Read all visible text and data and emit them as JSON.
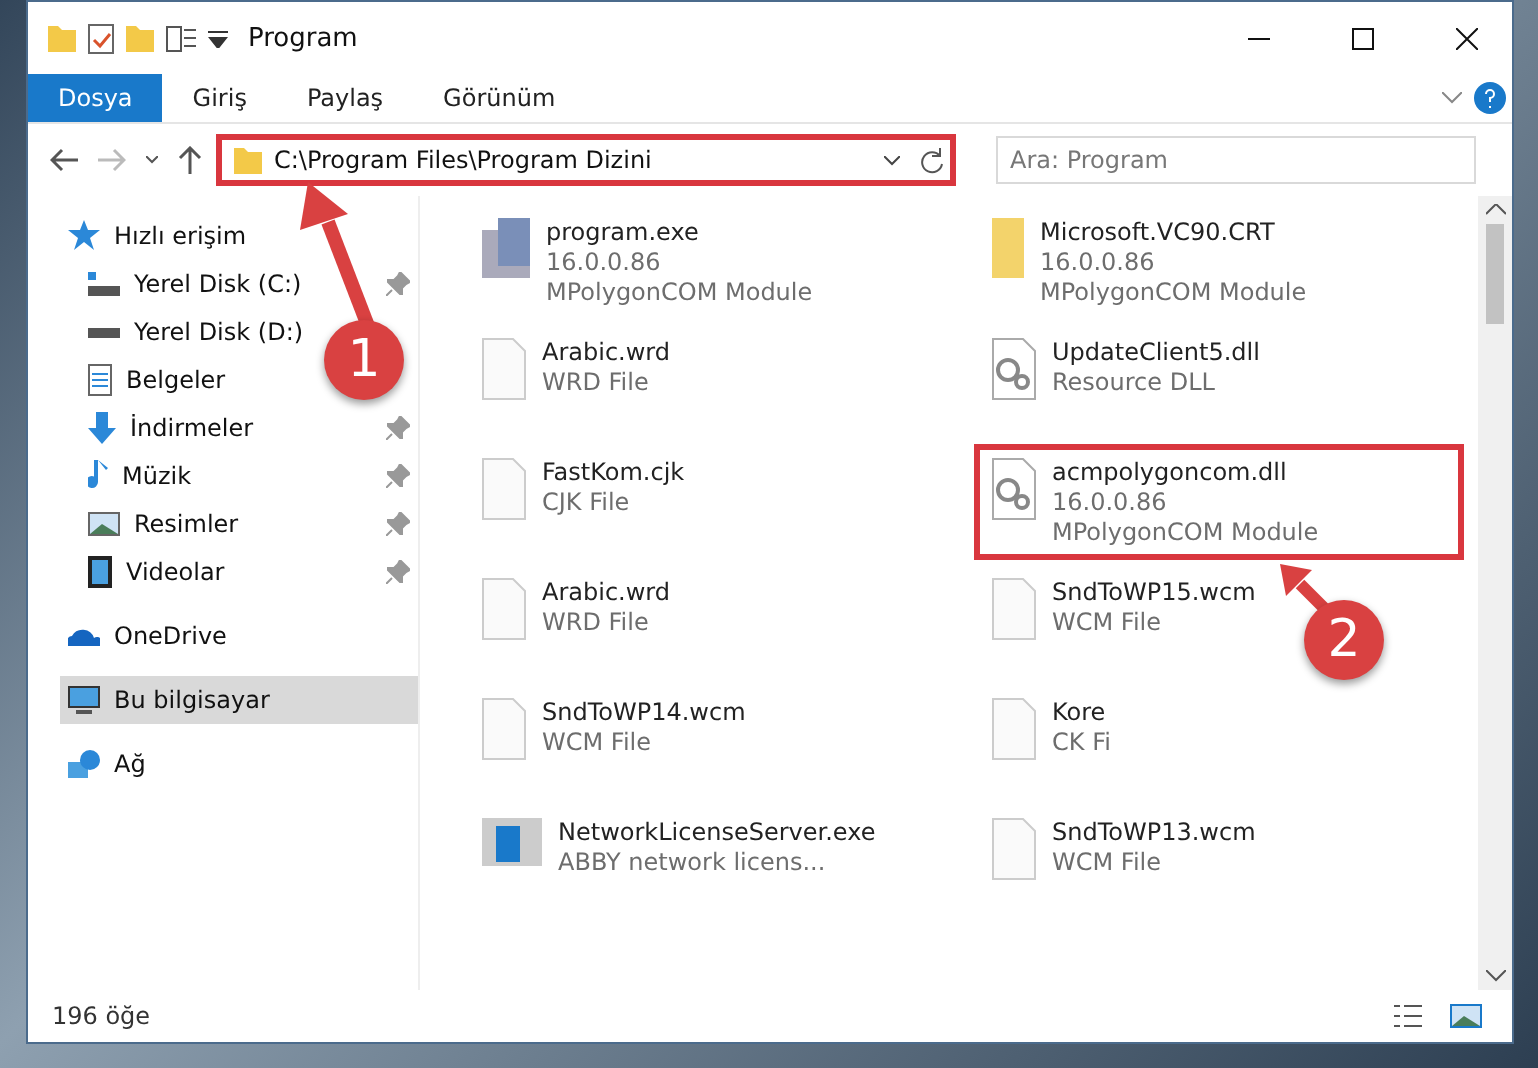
{
  "window": {
    "title": "Program"
  },
  "ribbon_tabs": [
    {
      "label": "Dosya",
      "selected": true
    },
    {
      "label": "Giriş",
      "selected": false
    },
    {
      "label": "Paylaş",
      "selected": false
    },
    {
      "label": "Görünüm",
      "selected": false
    }
  ],
  "address_bar": {
    "path": "C:\\Program Files\\Program Dizini",
    "highlighted": true
  },
  "search": {
    "placeholder": "Ara: Program"
  },
  "sidebar": {
    "items": [
      {
        "label": "Hızlı erişim",
        "selected": false,
        "children": [
          {
            "label": "Yerel Disk (C:)",
            "pinned": true
          },
          {
            "label": "Yerel Disk (D:)",
            "pinned": false
          },
          {
            "label": "Belgeler",
            "pinned": false
          },
          {
            "label": "İndirmeler",
            "pinned": true
          },
          {
            "label": "Müzik",
            "pinned": true
          },
          {
            "label": "Resimler",
            "pinned": true
          },
          {
            "label": "Videolar",
            "pinned": true
          }
        ]
      },
      {
        "label": "OneDrive",
        "selected": false
      },
      {
        "label": "Bu bilgisayar",
        "selected": true
      },
      {
        "label": "Ağ",
        "selected": false
      }
    ]
  },
  "files": [
    {
      "name": "program.exe",
      "lines": [
        "16.0.0.86",
        "MPolygonCOM Module"
      ],
      "kind": "app",
      "highlighted": false
    },
    {
      "name": "Microsoft.VC90.CRT",
      "lines": [
        "16.0.0.86",
        "MPolygonCOM Module"
      ],
      "kind": "manifest",
      "highlighted": false
    },
    {
      "name": "Arabic.wrd",
      "lines": [
        "WRD File"
      ],
      "kind": "doc",
      "highlighted": false
    },
    {
      "name": "UpdateClient5.dll",
      "lines": [
        "Resource DLL"
      ],
      "kind": "dll",
      "highlighted": false
    },
    {
      "name": "FastKom.cjk",
      "lines": [
        "CJK File"
      ],
      "kind": "doc",
      "highlighted": false
    },
    {
      "name": "acmpolygoncom.dll",
      "lines": [
        "16.0.0.86",
        "MPolygonCOM Module"
      ],
      "kind": "dll",
      "highlighted": true
    },
    {
      "name": "Arabic.wrd",
      "lines": [
        "WRD File"
      ],
      "kind": "doc",
      "highlighted": false
    },
    {
      "name": "SndToWP15.wcm",
      "lines": [
        "WCM File"
      ],
      "kind": "doc",
      "highlighted": false
    },
    {
      "name": "SndToWP14.wcm",
      "lines": [
        "WCM File"
      ],
      "kind": "doc",
      "highlighted": false
    },
    {
      "name": "Kore",
      "lines": [
        "CK Fi"
      ],
      "kind": "doc",
      "highlighted": false
    },
    {
      "name": "NetworkLicenseServer.exe",
      "lines": [
        "ABBY network licens..."
      ],
      "kind": "server",
      "highlighted": false
    },
    {
      "name": "SndToWP13.wcm",
      "lines": [
        "WCM File"
      ],
      "kind": "doc",
      "highlighted": false
    }
  ],
  "status_bar": {
    "count": "196 öğe"
  },
  "callouts": [
    "1",
    "2"
  ]
}
